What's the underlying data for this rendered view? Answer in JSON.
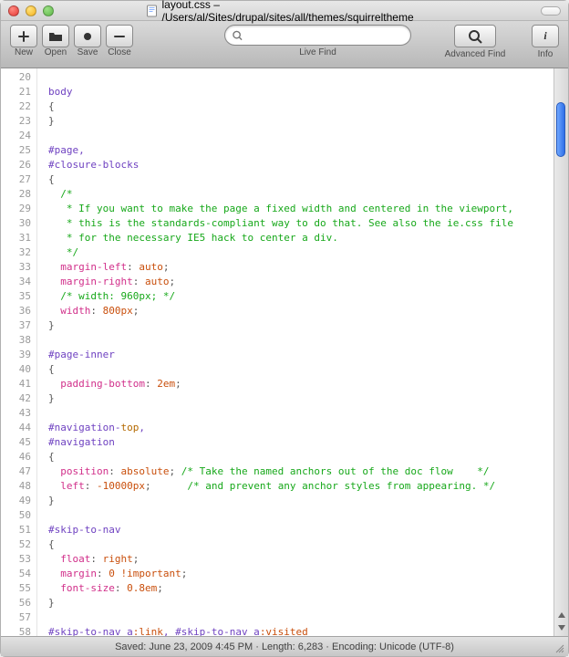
{
  "titlebar": {
    "filename": "layout.css",
    "path": "/Users/al/Sites/drupal/sites/all/themes/squirreltheme"
  },
  "toolbar": {
    "new_label": "New",
    "open_label": "Open",
    "save_label": "Save",
    "close_label": "Close",
    "livefind_label": "Live Find",
    "advfind_label": "Advanced Find",
    "info_label": "Info",
    "search_value": ""
  },
  "editor": {
    "first_line": 20,
    "last_line": 58
  },
  "code": {
    "l20": "",
    "l21": "body",
    "l22": "{",
    "l23": "}",
    "l24": "",
    "l25": "#page,",
    "l26": "#closure-blocks",
    "l27": "{",
    "l28a": "  /*",
    "l29": "   * If you want to make the page a fixed width and centered in the viewport,",
    "l30": "   * this is the standards-compliant way to do that. See also the ie.css file",
    "l31": "   * for the necessary IE5 hack to center a div.",
    "l32": "   */",
    "l33p": "  margin-left",
    "l33v": " auto",
    "l34p": "  margin-right",
    "l34v": " auto",
    "l35": "  /* width: 960px; */",
    "l36p": "  width",
    "l36v": " 800px",
    "l37": "}",
    "l38": "",
    "l39": "#page-inner",
    "l40": "{",
    "l41p": "  padding-bottom",
    "l41v": " 2em",
    "l42": "}",
    "l43": "",
    "l44a": "#navigation-",
    "l44b": "top",
    "l44c": ",",
    "l45": "#navigation",
    "l46": "{",
    "l47p": "  position",
    "l47v": " absolute",
    "l47c": " /* Take the named anchors out of the doc flow    */",
    "l48p": "  left",
    "l48v": " -10000px",
    "l48c": "    /* and prevent any anchor styles from appearing. */",
    "l49": "}",
    "l50": "",
    "l51": "#skip-to-nav",
    "l52": "{",
    "l53p": "  float",
    "l53v": " right",
    "l54p": "  margin",
    "l54v": " 0 !important",
    "l55p": "  font-size",
    "l55v": " 0.8em",
    "l56": "}",
    "l57": "",
    "l58a": "#skip-to-nav a",
    "l58b": ":link",
    "l58c": ", ",
    "l58d": "#skip-to-nav a",
    "l58e": ":visited"
  },
  "statusbar": {
    "saved_prefix": "Saved: ",
    "saved_time": "June 23, 2009 4:45 PM",
    "sep": "  ·  ",
    "length_prefix": "Length: ",
    "length": "6,283",
    "encoding_prefix": "Encoding: ",
    "encoding": "Unicode (UTF-8)"
  }
}
